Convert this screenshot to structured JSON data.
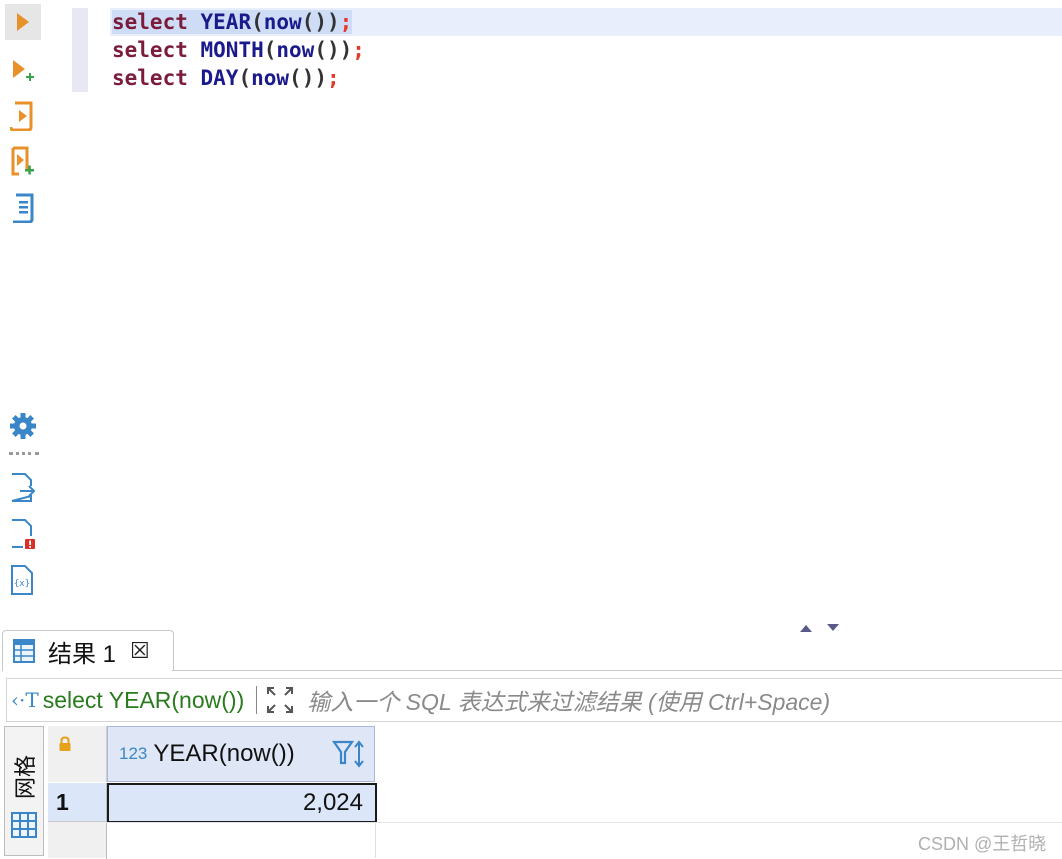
{
  "toolbar": {
    "items": [
      {
        "name": "execute-statement",
        "icon": "play-triangle"
      },
      {
        "name": "execute-new-tab",
        "icon": "play-plus"
      },
      {
        "name": "execute-script",
        "icon": "script-play"
      },
      {
        "name": "execute-script-new-tab",
        "icon": "script-play-plus"
      },
      {
        "name": "explain-plan",
        "icon": "document-lines"
      }
    ],
    "bottom_items": [
      {
        "name": "settings",
        "icon": "gear"
      },
      {
        "name": "export",
        "icon": "document-arrow"
      },
      {
        "name": "problems",
        "icon": "document-error"
      },
      {
        "name": "variables",
        "icon": "document-variables"
      }
    ],
    "variables_glyph": "{x}"
  },
  "editor": {
    "lines": [
      {
        "kw": "select",
        "fn": "YEAR",
        "open": "(",
        "inner": "now",
        "close": "())",
        "semi": ";"
      },
      {
        "kw": "select",
        "fn": "MONTH",
        "open": "(",
        "inner": "now",
        "close": "())",
        "semi": ";"
      },
      {
        "kw": "select",
        "fn": "DAY",
        "open": "(",
        "inner": "now",
        "close": "())",
        "semi": ";"
      }
    ]
  },
  "results": {
    "tab_label": "结果 1",
    "close_glyph": "☒",
    "filter": {
      "icon_text": "‹·T",
      "query": "select YEAR(now())",
      "placeholder": "输入一个 SQL 表达式来过滤结果 (使用 Ctrl+Space)"
    },
    "side_tab_label": "网格",
    "columns": [
      {
        "type_badge": "123",
        "name": "YEAR(now())"
      }
    ],
    "rows": [
      {
        "num": "1",
        "values": [
          "2,024"
        ]
      }
    ]
  },
  "watermark": "CSDN @王哲晓",
  "colors": {
    "keyword": "#7a1c3a",
    "function": "#1a1a8c",
    "semicolon": "#e23b2e",
    "toolbar_orange": "#e8912a",
    "toolbar_blue": "#3a86c8",
    "selection": "#cfdcf6",
    "filter_text": "#2a7a1e"
  }
}
